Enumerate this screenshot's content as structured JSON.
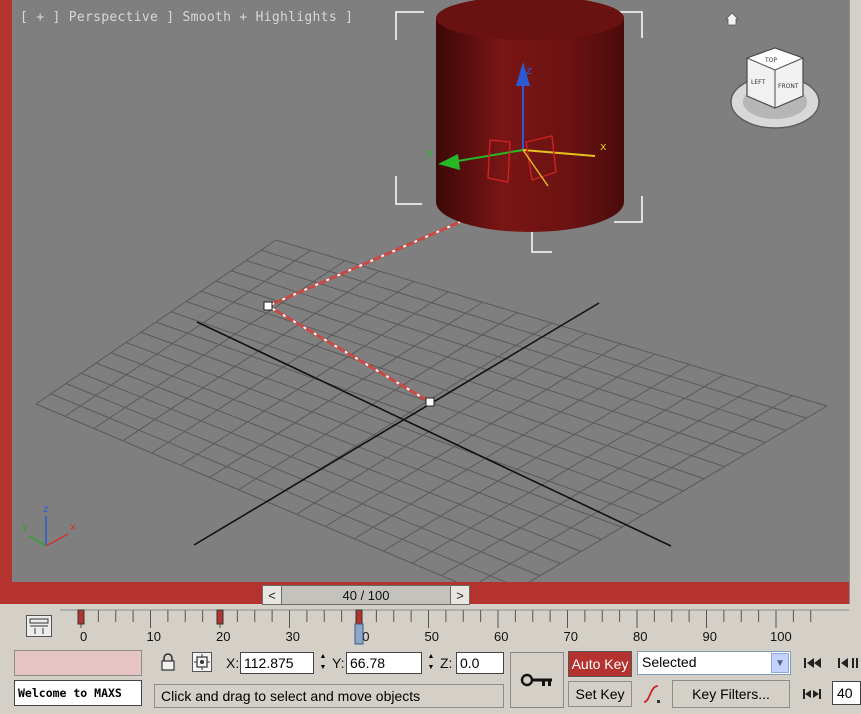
{
  "viewport": {
    "label": "[ + ] Perspective ] Smooth + Highlights ]",
    "active_border_color": "#b4332f",
    "background_color": "#7f7f7f",
    "object_color": "#7a1515",
    "gizmo_axes": {
      "x": "x",
      "y": "y",
      "z": "z"
    },
    "axis_tripod": {
      "x": "x",
      "y": "y",
      "z": "z"
    },
    "view_cube_faces": {
      "top": "TOP",
      "front": "FRONT",
      "left": "LEFT"
    }
  },
  "time_slider": {
    "prev": "<",
    "next": ">",
    "label": "40 / 100",
    "current_frame": 40,
    "total_frames": 100
  },
  "track_bar": {
    "ticks": [
      "0",
      "10",
      "20",
      "30",
      "40",
      "50",
      "60",
      "70",
      "80",
      "90",
      "100"
    ],
    "keyframes": [
      0,
      20,
      40
    ]
  },
  "status": {
    "maxscript_output": "Welcome to MAXS",
    "prompt": "Click and drag to select and move objects"
  },
  "coordinates": {
    "x_label": "X:",
    "x_value": "112.875",
    "y_label": "Y:",
    "y_value": "66.78",
    "z_label": "Z:",
    "z_value": "0.0"
  },
  "animation": {
    "auto_key": "Auto Key",
    "set_key": "Set Key",
    "selection_filter": "Selected",
    "key_filters": "Key Filters...",
    "current_frame_field": "40",
    "auto_key_color": "#b4332f"
  }
}
